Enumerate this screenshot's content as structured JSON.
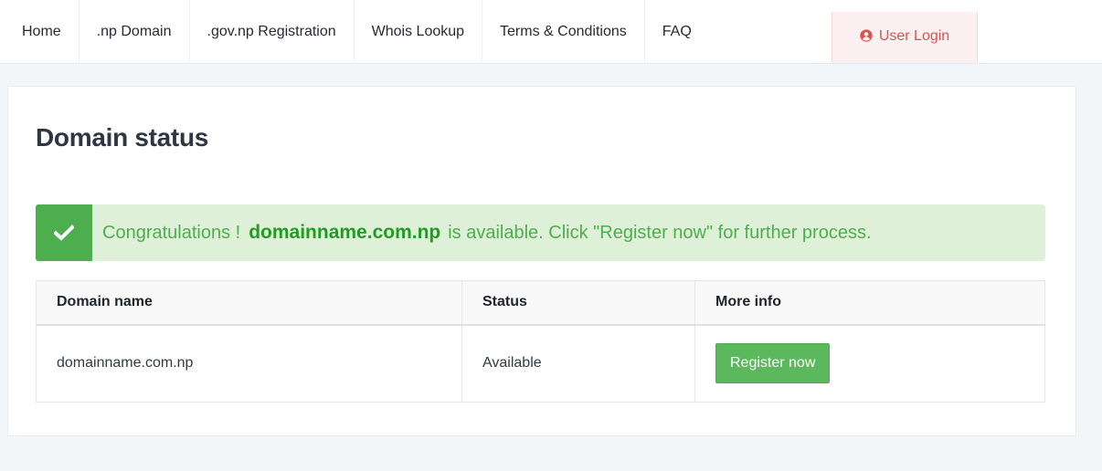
{
  "nav": {
    "items": [
      {
        "label": "Home"
      },
      {
        "label": ".np Domain"
      },
      {
        "label": ".gov.np Registration"
      },
      {
        "label": "Whois Lookup"
      },
      {
        "label": "Terms & Conditions"
      },
      {
        "label": "FAQ"
      }
    ],
    "login_label": "User Login",
    "login_icon": "user-circle-icon"
  },
  "page": {
    "title": "Domain status"
  },
  "alert": {
    "icon": "checkmark-icon",
    "prefix": "Congratulations !",
    "domain": "domainname.com.np",
    "suffix": "is available. Click \"Register now\" for further process."
  },
  "table": {
    "headers": {
      "domain": "Domain name",
      "status": "Status",
      "info": "More info"
    },
    "rows": [
      {
        "domain": "domainname.com.np",
        "status": "Available",
        "action": "Register now"
      }
    ]
  },
  "colors": {
    "success": "#4cae4c",
    "success_bg": "#dff0d8",
    "danger": "#d9534f",
    "danger_bg": "#fdf0f0",
    "button": "#5cb85c"
  }
}
